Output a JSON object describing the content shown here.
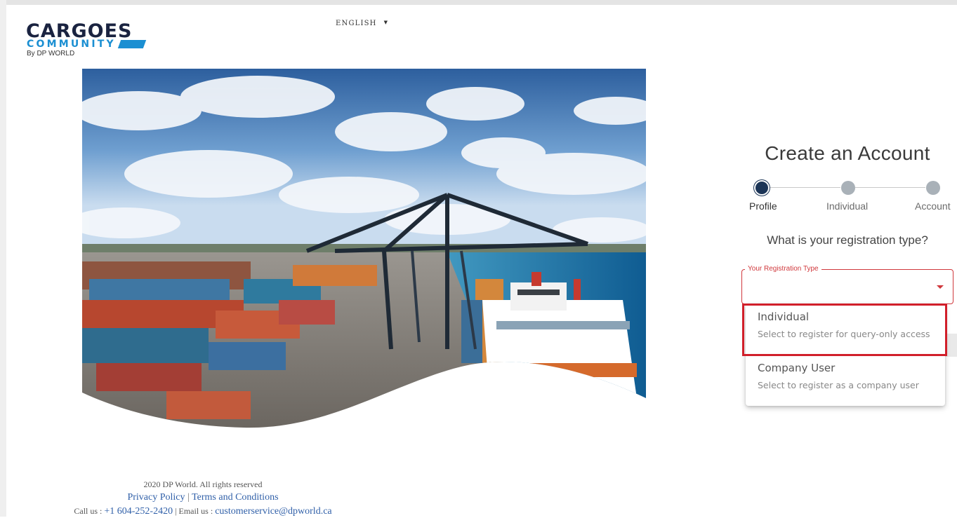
{
  "logo": {
    "brand": "CARGOES",
    "sub": "COMMUNITY",
    "by": "By DP WORLD"
  },
  "language": {
    "selected": "ENGLISH",
    "caret_icon": "caret-down-icon"
  },
  "hero": {
    "icon": "port-cranes-photo"
  },
  "registration": {
    "title": "Create an Account",
    "steps": [
      {
        "label": "Profile",
        "active": true
      },
      {
        "label": "Individual",
        "active": false
      },
      {
        "label": "Account",
        "active": false
      }
    ],
    "question": "What is your registration type?",
    "select": {
      "label": "Your Registration Type",
      "value": "",
      "accent_color": "#d0383c"
    },
    "options": [
      {
        "title": "Individual",
        "description": "Select to register for query-only access"
      },
      {
        "title": "Company User",
        "description": "Select to register as a company user"
      }
    ],
    "highlight_color": "#d11f2a"
  },
  "footer": {
    "copyright": "2020 DP World. All rights reserved",
    "privacy": "Privacy Policy",
    "separator": "|",
    "terms": "Terms and Conditions",
    "call_label": "Call us :",
    "phone": "+1 604-252-2420",
    "email_label": "| Email us :",
    "email": "customerservice@dpworld.ca"
  }
}
